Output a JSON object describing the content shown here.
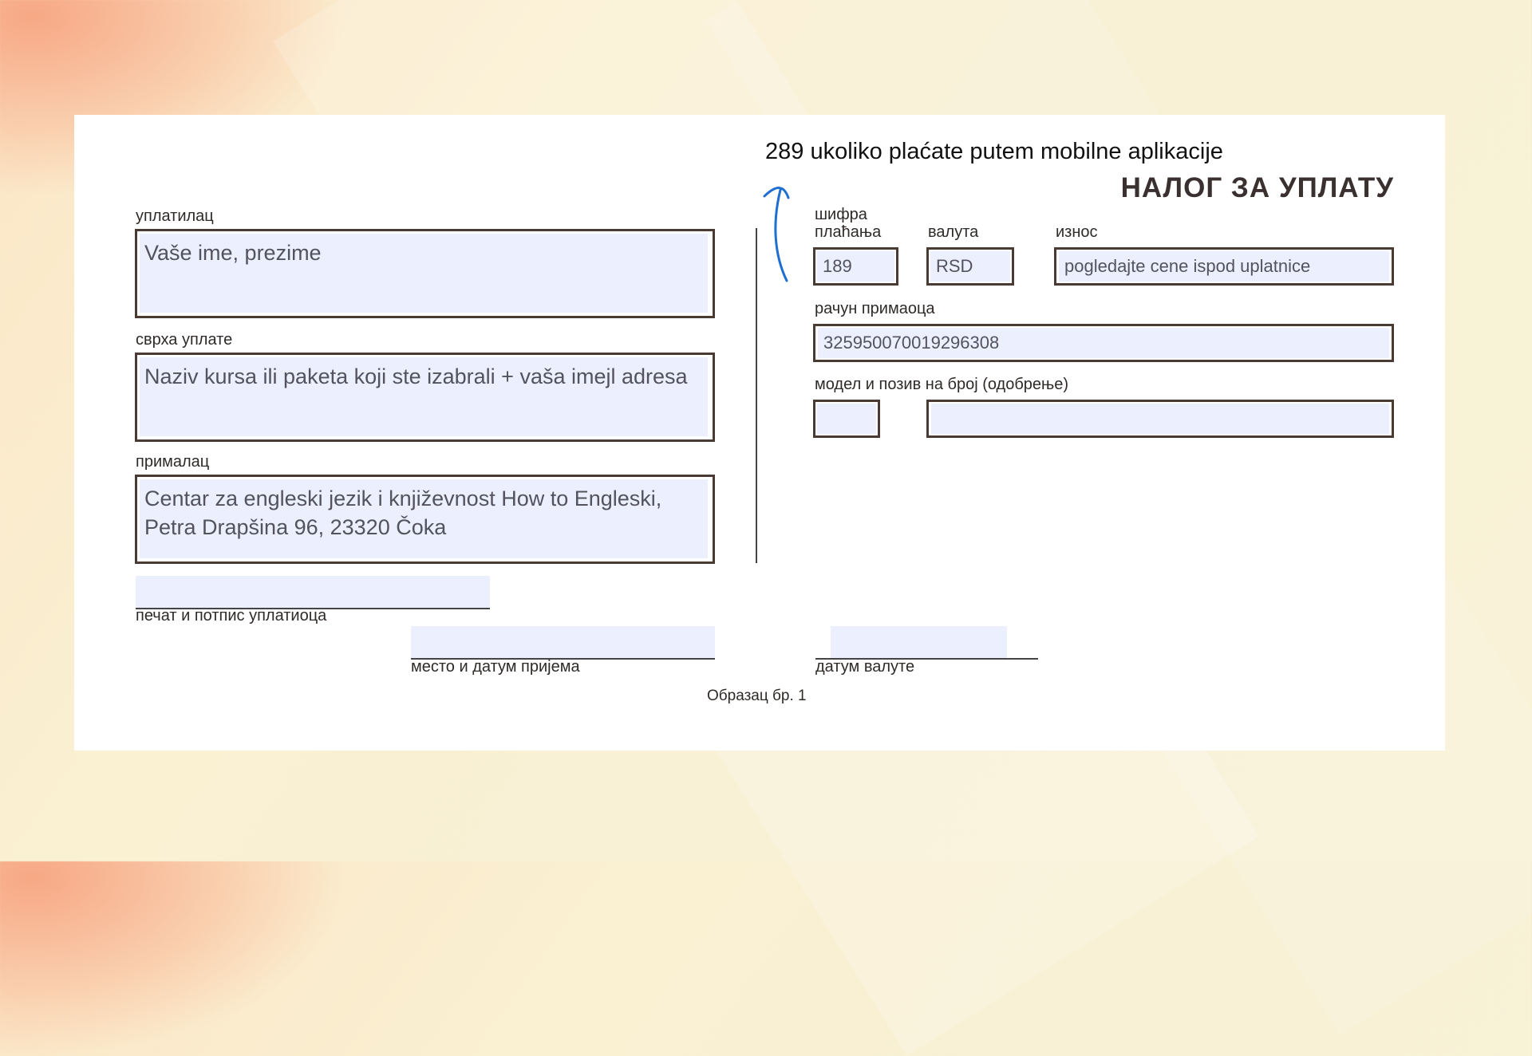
{
  "note": "289 ukoliko plaćate putem mobilne aplikacije",
  "form": {
    "title": "НАЛОГ ЗА УПЛАТУ",
    "payer_label": "уплатилац",
    "payer_value": "Vaše ime, prezime",
    "purpose_label": "сврха уплате",
    "purpose_value": "Naziv kursa ili paketa koji ste izabrali + vaša imejl adresa",
    "recipient_label": "прималац",
    "recipient_value": "Centar za engleski jezik i književnost How to Engleski,\nPetra Drapšina 96, 23320 Čoka",
    "payment_code_label": "шифра\nплаћања",
    "payment_code_value": "189",
    "currency_label": "валута",
    "currency_value": "RSD",
    "amount_label": "износ",
    "amount_value": "pogledajte cene ispod uplatnice",
    "account_label": "рачун примаоца",
    "account_value": "325950070019296308",
    "model_label": "модел и позив на број (одобрење)",
    "model_value": "",
    "reference_value": "",
    "signature_label": "печат и потпис уплатиоца",
    "place_date_label": "место и датум пријема",
    "value_date_label": "датум валуте",
    "form_number": "Образац бр. 1"
  },
  "colors": {
    "field_fill": "#eceffe",
    "border": "#4a3a34",
    "arrow": "#1f6fd1"
  },
  "icons": {
    "annotation_arrow": "arrow-up-icon"
  }
}
